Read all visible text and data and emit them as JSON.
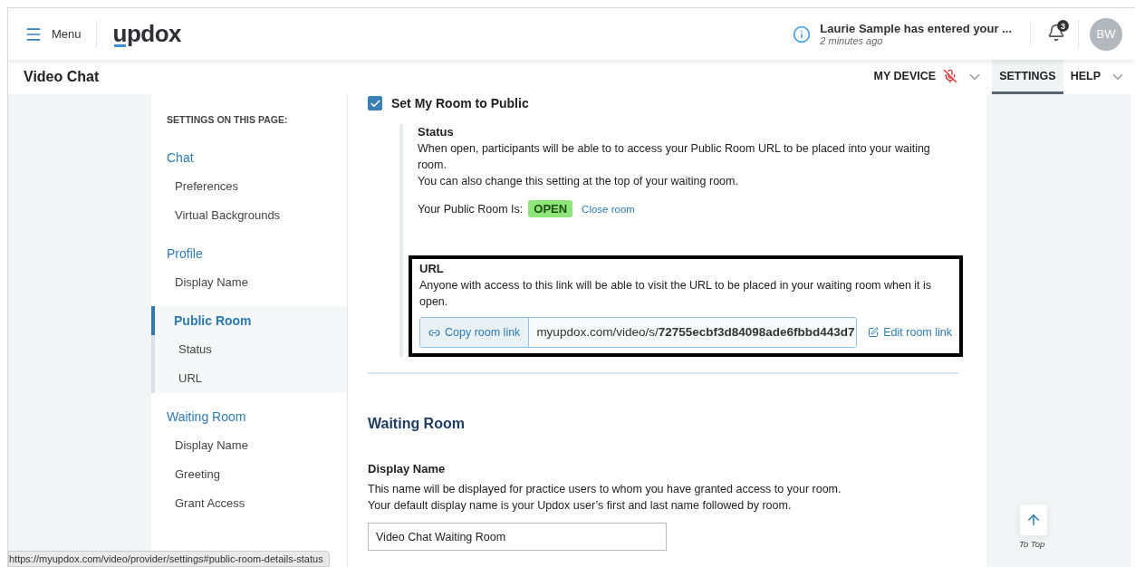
{
  "header": {
    "menu_label": "Menu",
    "logo": "updox",
    "notification": {
      "message": "Laurie Sample has entered your ...",
      "time": "2 minutes ago"
    },
    "bell_count": "3",
    "avatar": "BW"
  },
  "subheader": {
    "title": "Video Chat",
    "nav": [
      {
        "label": "MY DEVICE",
        "kind": "device",
        "selected": false,
        "muted": true
      },
      {
        "label": "SETTINGS",
        "kind": "plain",
        "selected": true
      },
      {
        "label": "HELP",
        "kind": "dropdown",
        "selected": false
      }
    ]
  },
  "sidebar": {
    "heading": "SETTINGS ON THIS PAGE:",
    "sections": [
      {
        "title": "Chat",
        "selected": false,
        "children": [
          {
            "label": "Preferences"
          },
          {
            "label": "Virtual Backgrounds"
          }
        ]
      },
      {
        "title": "Profile",
        "selected": false,
        "children": [
          {
            "label": "Display Name"
          }
        ]
      },
      {
        "title": "Public Room",
        "selected": true,
        "children": [
          {
            "label": "Status"
          },
          {
            "label": "URL"
          }
        ]
      },
      {
        "title": "Waiting Room",
        "selected": false,
        "children": [
          {
            "label": "Display Name"
          },
          {
            "label": "Greeting"
          },
          {
            "label": "Grant Access"
          }
        ]
      }
    ]
  },
  "public_room": {
    "checkbox": {
      "label": "Set My Room to Public",
      "checked": true
    },
    "status": {
      "title": "Status",
      "text": "When open, participants will be able to to access your Public Room URL to be placed into your waiting room.",
      "note": "You can also change this setting at the top of your waiting room.",
      "room_label": "Your Public Room Is:",
      "room_state": "OPEN",
      "close_link": "Close room"
    },
    "url": {
      "title": "URL",
      "text": "Anyone with access to this link will be able to visit the URL to be placed in your waiting room when it is open.",
      "copy_button": "Copy room link",
      "link": "myupdox.com/video/s/**72755ecbf3d84098ade6fbbd443d7**",
      "edit_link": "Edit room link",
      "highlighted": true
    }
  },
  "waiting_room": {
    "title": "Waiting Room",
    "display_name": {
      "title": "Display Name",
      "text": "This name will be displayed for practice users to whom you have granted access to your room.",
      "note": "Your default display name is your Updox user’s first and last name followed by room.",
      "value": "Video Chat Waiting Room"
    }
  },
  "to_top": "To Top",
  "status_url": "https://myupdox.com/video/provider/settings#public-room-details-status"
}
